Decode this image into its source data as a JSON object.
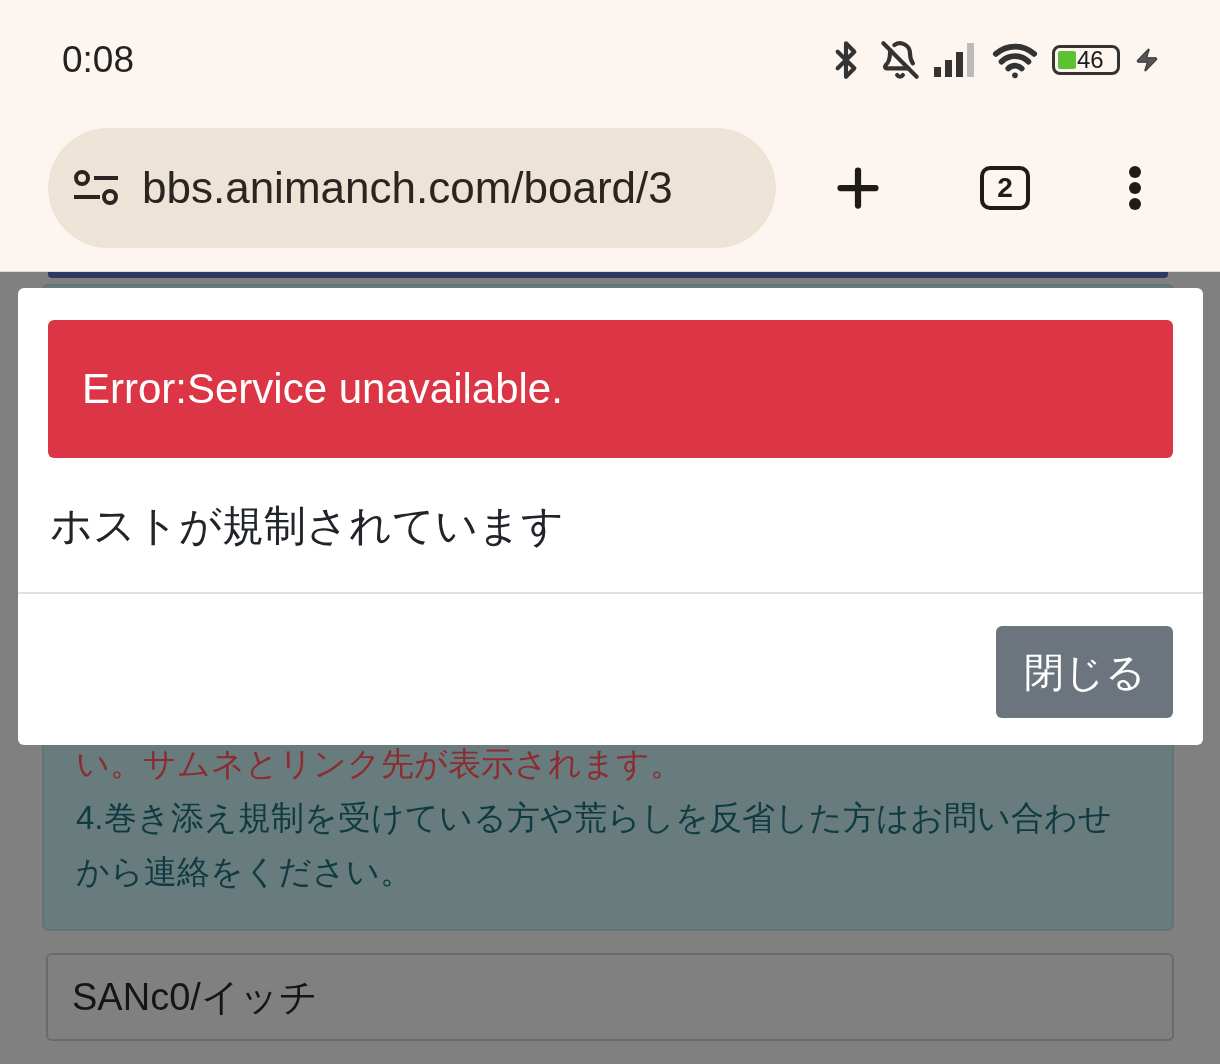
{
  "status_bar": {
    "time": "0:08",
    "battery": "46"
  },
  "browser": {
    "url": "bbs.animanch.com/board/3",
    "tab_count": "2"
  },
  "notice": {
    "lines": [
      {
        "kind": "warning",
        "text": "い。サムネとリンク先が表示されます。"
      },
      {
        "kind": "plain",
        "text": "4.巻き添え規制を受けている方や荒らしを反省した方はお問い合わせから連絡をください。"
      }
    ]
  },
  "name_field": {
    "value": "SANc0/イッチ"
  },
  "modal": {
    "alert": "Error:Service unavailable.",
    "message": "ホストが規制されています",
    "close_button": "閉じる"
  }
}
